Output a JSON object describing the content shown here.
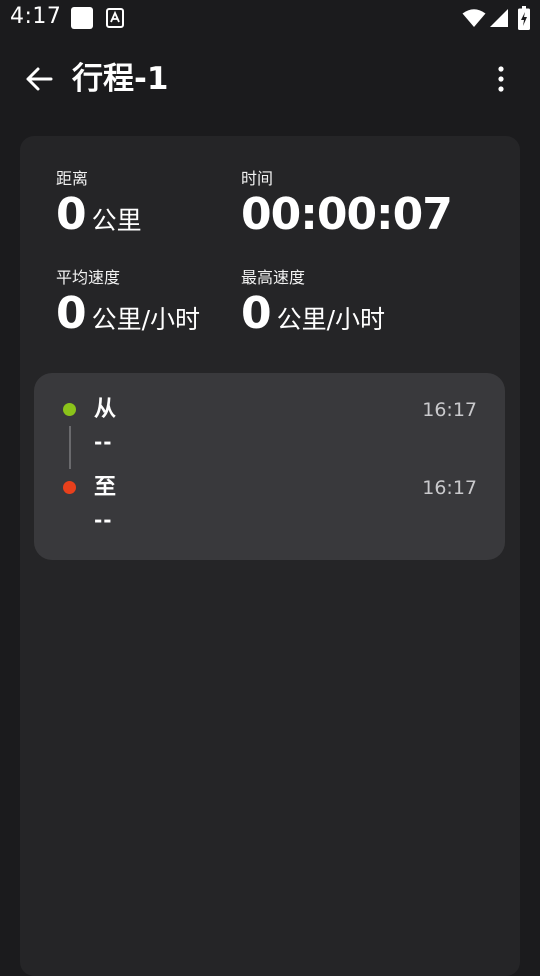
{
  "status_bar": {
    "time": "4:17",
    "icons": [
      "notification-square-icon",
      "accessibility-a-icon",
      "wifi-icon",
      "signal-icon",
      "battery-charging-icon"
    ]
  },
  "app_bar": {
    "title": "行程-1",
    "back_icon": "arrow-left-icon",
    "more_icon": "more-vertical-icon"
  },
  "stats": {
    "distance": {
      "label": "距离",
      "value": "0",
      "unit": "公里"
    },
    "duration": {
      "label": "时间",
      "value": "00:00:07"
    },
    "avg_speed": {
      "label": "平均速度",
      "value": "0",
      "unit": "公里/小时"
    },
    "max_speed": {
      "label": "最高速度",
      "value": "0",
      "unit": "公里/小时"
    }
  },
  "route": {
    "from": {
      "label": "从",
      "place": "--",
      "time": "16:17",
      "color": "#8bc31a"
    },
    "to": {
      "label": "至",
      "place": "--",
      "time": "16:17",
      "color": "#e8401c"
    }
  },
  "colors": {
    "background": "#1b1b1d",
    "card": "#252527",
    "route_box": "#39393c"
  }
}
